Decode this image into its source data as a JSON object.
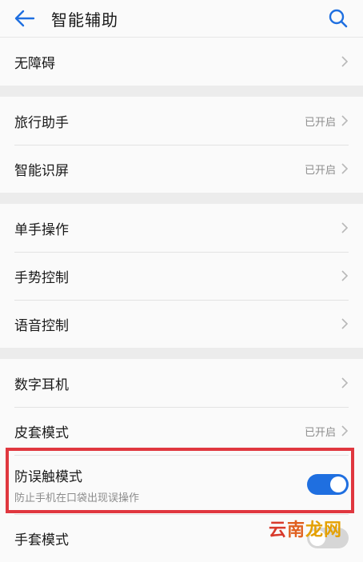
{
  "header": {
    "title": "智能辅助",
    "back_icon": "arrow-left-icon",
    "search_icon": "search-icon",
    "accent": "#1f6fe0"
  },
  "groups": [
    {
      "items": [
        {
          "label": "无障碍",
          "status": ""
        }
      ]
    },
    {
      "items": [
        {
          "label": "旅行助手",
          "status": "已开启"
        },
        {
          "label": "智能识屏",
          "status": "已开启"
        }
      ]
    },
    {
      "items": [
        {
          "label": "单手操作",
          "status": ""
        },
        {
          "label": "手势控制",
          "status": ""
        },
        {
          "label": "语音控制",
          "status": ""
        }
      ]
    },
    {
      "items": [
        {
          "label": "数字耳机",
          "status": ""
        },
        {
          "label": "皮套模式",
          "status": "已开启"
        },
        {
          "label": "防误触模式",
          "subtitle": "防止手机在口袋出现误操作",
          "toggle": true
        },
        {
          "label": "手套模式",
          "toggle": false
        }
      ]
    }
  ],
  "watermark": {
    "part1": "云",
    "part2": "南",
    "part3": "龙网"
  },
  "highlight_color": "#e0373f"
}
